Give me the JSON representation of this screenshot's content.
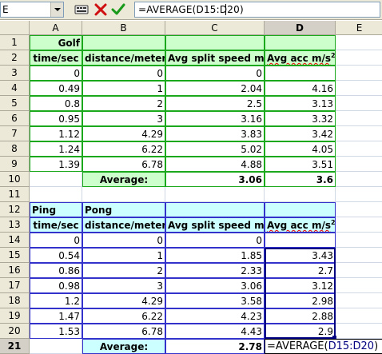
{
  "namebox": {
    "value": "E"
  },
  "formula": {
    "text": "=AVERAGE(D15:D20)"
  },
  "columns": [
    "A",
    "B",
    "C",
    "D",
    "E"
  ],
  "rows": [
    "1",
    "2",
    "3",
    "4",
    "5",
    "6",
    "7",
    "8",
    "9",
    "10",
    "11",
    "12",
    "13",
    "14",
    "15",
    "16",
    "17",
    "18",
    "19",
    "20",
    "21"
  ],
  "golf": {
    "title": "Golf",
    "headers": [
      "time/sec",
      "distance/meters",
      "Avg split speed m/s",
      "Avg acc m/s"
    ],
    "sup": "2",
    "data": [
      [
        "0",
        "0",
        "0",
        ""
      ],
      [
        "0.49",
        "1",
        "2.04",
        "4.16"
      ],
      [
        "0.8",
        "2",
        "2.5",
        "3.13"
      ],
      [
        "0.95",
        "3",
        "3.16",
        "3.32"
      ],
      [
        "1.12",
        "4.29",
        "3.83",
        "3.42"
      ],
      [
        "1.24",
        "6.22",
        "5.02",
        "4.05"
      ],
      [
        "1.39",
        "6.78",
        "4.88",
        "3.51"
      ]
    ],
    "avg_label": "Average:",
    "avg_c": "3.06",
    "avg_d": "3.6"
  },
  "pingpong": {
    "title_a": "Ping",
    "title_b": "Pong",
    "headers": [
      "time/sec",
      "distance/meters",
      "Avg split speed m/s",
      "Avg acc m/s"
    ],
    "sup": "2",
    "data": [
      [
        "0",
        "0",
        "0",
        ""
      ],
      [
        "0.54",
        "1",
        "1.85",
        "3.43"
      ],
      [
        "0.86",
        "2",
        "2.33",
        "2.7"
      ],
      [
        "0.98",
        "3",
        "3.06",
        "3.12"
      ],
      [
        "1.2",
        "4.29",
        "3.58",
        "2.98"
      ],
      [
        "1.47",
        "6.22",
        "4.23",
        "2.88"
      ],
      [
        "1.53",
        "6.78",
        "4.43",
        "2.9"
      ]
    ],
    "avg_label": "Average:",
    "avg_c": "2.78",
    "edit_prefix": "=AVERAGE(",
    "edit_ref": "D15:D20",
    "edit_suffix": ")"
  },
  "colors": {
    "green_border": "#1ca81c",
    "blue_border": "#3333cc",
    "green_fill": "#ccffcc",
    "cyan_fill": "#ccffff",
    "ref_highlight": "#000080"
  },
  "icons": [
    "namebox-dropdown-icon",
    "function-wizard-icon",
    "cancel-icon",
    "accept-icon"
  ]
}
